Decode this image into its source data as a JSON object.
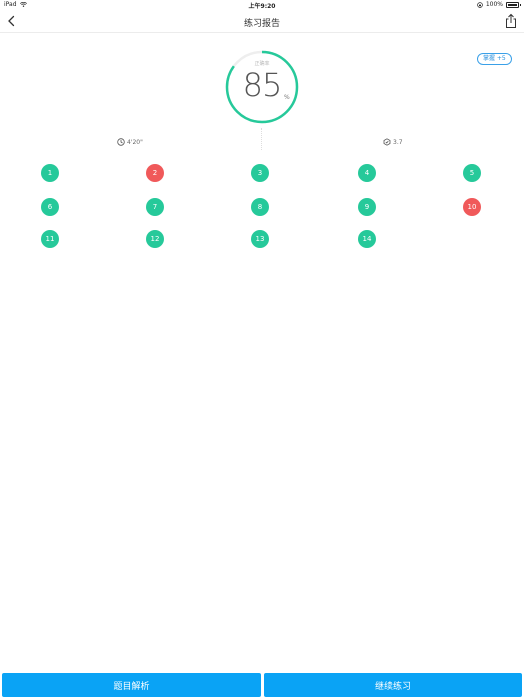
{
  "status_bar": {
    "device": "iPad",
    "time": "上午9:20",
    "battery": "100%"
  },
  "nav": {
    "title": "练习报告"
  },
  "score": {
    "label": "正确率",
    "value": "85",
    "unit": "%",
    "fraction": 0.85
  },
  "mastery": {
    "label": "掌握 +5"
  },
  "stats": {
    "time": "4'20\"",
    "level": "3.7"
  },
  "questions": [
    {
      "num": "1",
      "status": "correct"
    },
    {
      "num": "2",
      "status": "wrong"
    },
    {
      "num": "3",
      "status": "correct"
    },
    {
      "num": "4",
      "status": "correct"
    },
    {
      "num": "5",
      "status": "correct"
    },
    {
      "num": "6",
      "status": "correct"
    },
    {
      "num": "7",
      "status": "correct"
    },
    {
      "num": "8",
      "status": "correct"
    },
    {
      "num": "9",
      "status": "correct"
    },
    {
      "num": "10",
      "status": "wrong"
    },
    {
      "num": "11",
      "status": "correct"
    },
    {
      "num": "12",
      "status": "correct"
    },
    {
      "num": "13",
      "status": "correct"
    },
    {
      "num": "14",
      "status": "correct"
    }
  ],
  "actions": {
    "analysis_label": "题目解析",
    "continue_label": "继续练习"
  },
  "colors": {
    "accent": "#26c99a",
    "wrong": "#f0595a",
    "button": "#0aa3f5",
    "badge": "#3aa0e8"
  }
}
